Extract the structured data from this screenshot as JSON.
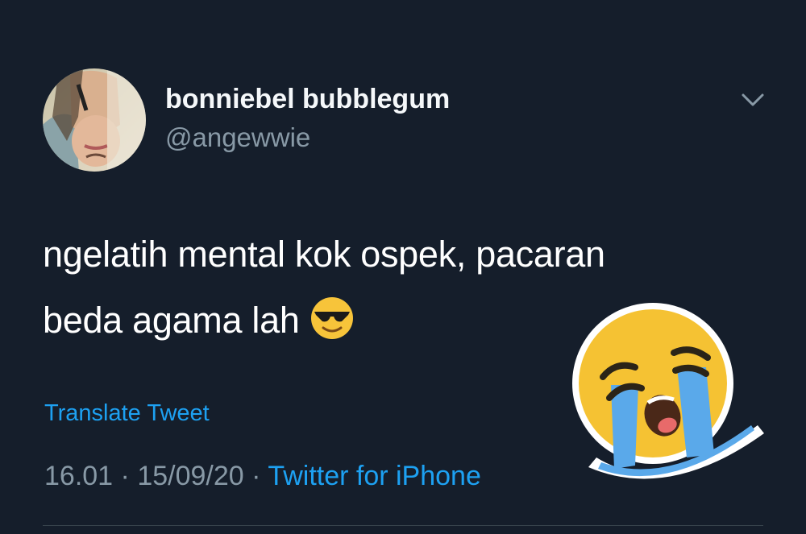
{
  "tweet": {
    "display_name": "bonniebel bubblegum",
    "handle": "@angewwie",
    "text_line1": "ngelatih mental kok ospek, pacaran",
    "text_line2": "beda agama lah",
    "text_emoji": "smiling-face-with-sunglasses-icon",
    "translate_label": "Translate Tweet",
    "time": "16.01",
    "separator": "·",
    "date": "15/09/20",
    "source": "Twitter for iPhone"
  },
  "icons": {
    "menu": "chevron-down-icon",
    "sticker": "loudly-crying-face-icon"
  },
  "colors": {
    "background": "#151e2b",
    "accent": "#1da1f2",
    "secondary_text": "#8899a6",
    "primary_text": "#ffffff"
  }
}
